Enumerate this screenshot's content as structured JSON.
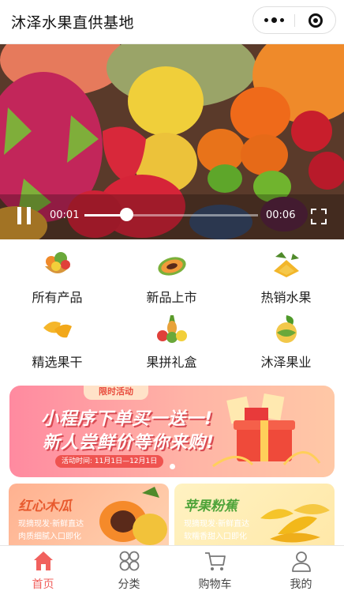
{
  "header": {
    "title": "沐泽水果直供基地",
    "more_icon": "more-dots-icon",
    "close_icon": "target-circle-icon"
  },
  "video": {
    "current_time": "00:01",
    "duration": "00:06",
    "progress": 0.24,
    "state": "playing",
    "pause_icon": "pause-icon",
    "fullscreen_icon": "fullscreen-icon"
  },
  "categories": [
    {
      "label": "所有产品",
      "icon": "fruit-basket-icon"
    },
    {
      "label": "新品上市",
      "icon": "papaya-icon"
    },
    {
      "label": "热销水果",
      "icon": "mango-icon"
    },
    {
      "label": "精选果干",
      "icon": "dried-mango-icon"
    },
    {
      "label": "果拼礼盒",
      "icon": "fruit-platter-icon"
    },
    {
      "label": "沐泽果业",
      "icon": "brand-leaf-icon"
    }
  ],
  "banner": {
    "tag": "限时活动",
    "line1": "小程序下单买一送一!",
    "line2": "新人尝鲜价等你来购!",
    "dates": "活动时间: 11月1日—12月1日"
  },
  "products": [
    {
      "title": "红心木瓜",
      "desc": "现摘现发·新鲜直达 肉质细腻入口即化"
    },
    {
      "title": "苹果粉蕉",
      "desc": "现摘现发·新鲜直达 软糯香甜入口即化"
    }
  ],
  "tabbar": {
    "items": [
      {
        "label": "首页",
        "icon": "home-icon",
        "active": true
      },
      {
        "label": "分类",
        "icon": "category-grid-icon",
        "active": false
      },
      {
        "label": "购物车",
        "icon": "cart-icon",
        "active": false
      },
      {
        "label": "我的",
        "icon": "profile-icon",
        "active": false
      }
    ]
  },
  "colors": {
    "accent": "#f1615e",
    "banner_gradient_start": "#ff8aa0",
    "banner_gradient_end": "#ffc8a6"
  }
}
